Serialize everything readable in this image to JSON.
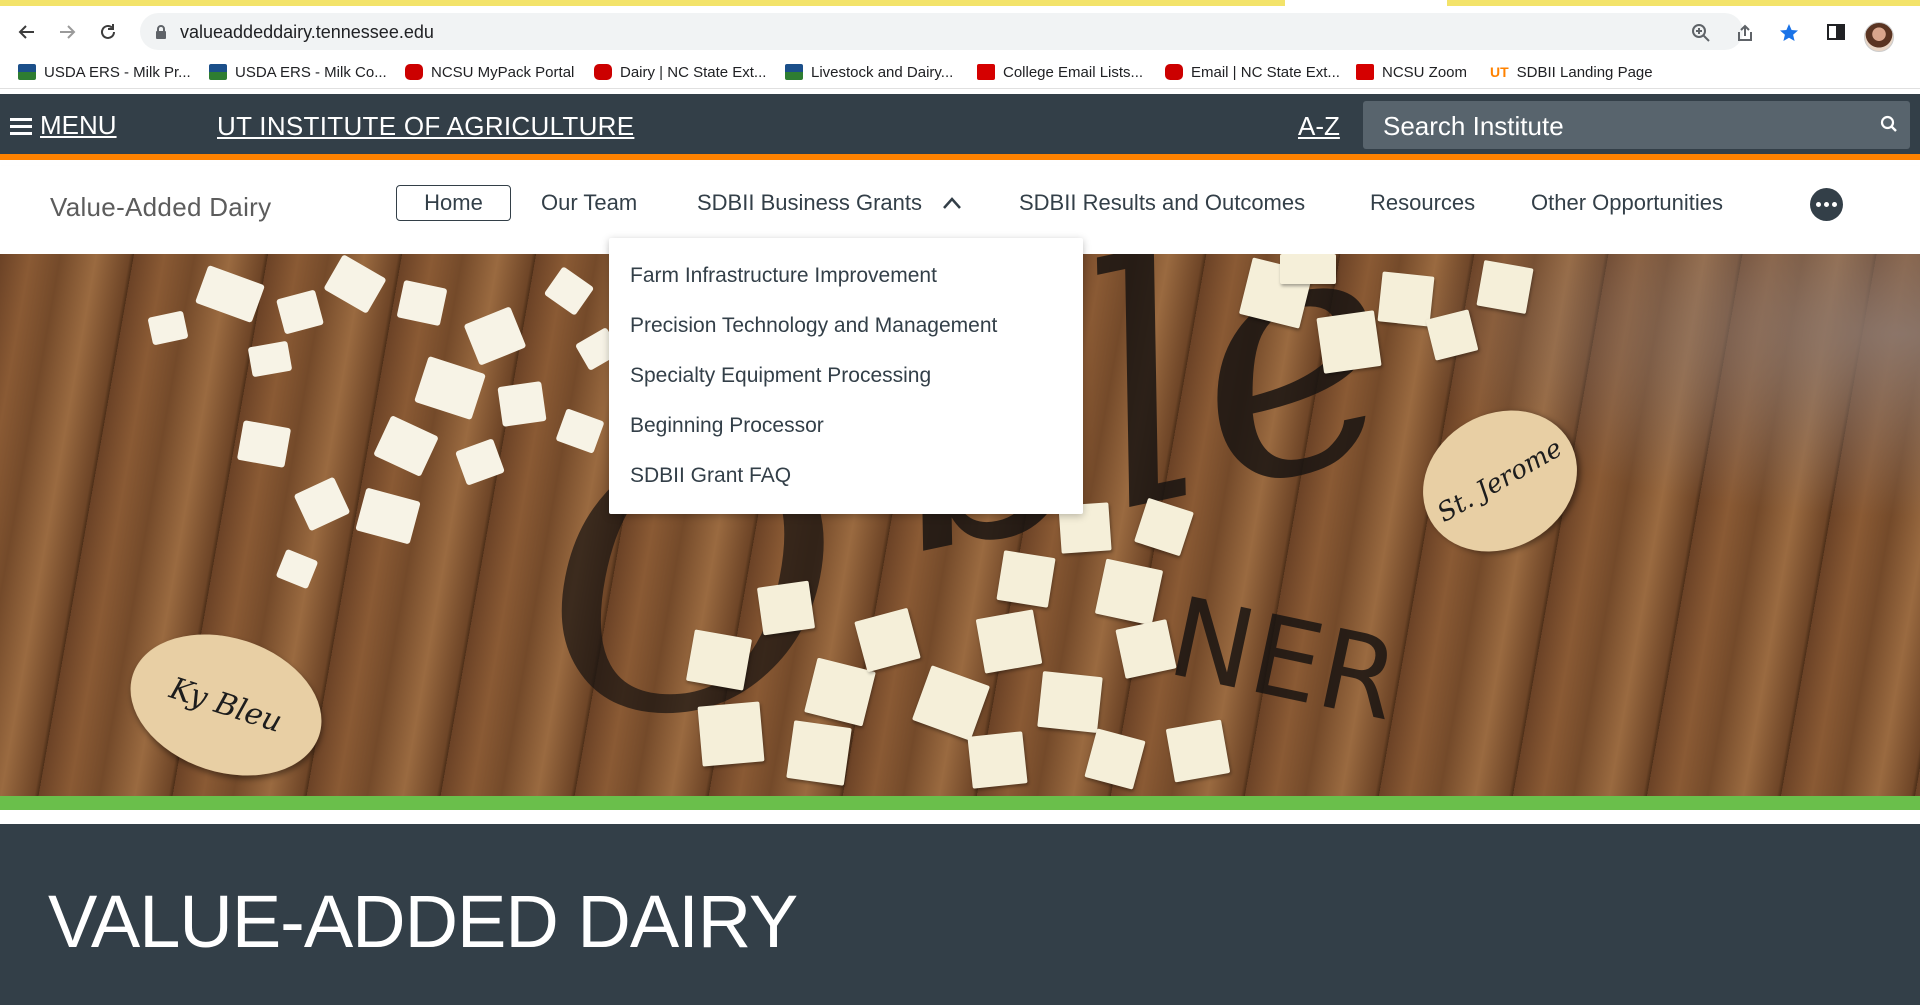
{
  "browser": {
    "url": "valueaddeddairy.tennessee.edu",
    "bookmarks": [
      {
        "label": "USDA ERS - Milk Pr...",
        "icon": "usda-icon"
      },
      {
        "label": "USDA ERS - Milk Co...",
        "icon": "usda-icon"
      },
      {
        "label": "NCSU MyPack Portal",
        "icon": "ncsu-icon"
      },
      {
        "label": "Dairy | NC State Ext...",
        "icon": "ncsu-icon"
      },
      {
        "label": "Livestock and Dairy...",
        "icon": "usda-icon"
      },
      {
        "label": "College Email Lists...",
        "icon": "wolf-icon"
      },
      {
        "label": "Email | NC State Ext...",
        "icon": "ncsu-icon"
      },
      {
        "label": "NCSU Zoom",
        "icon": "wolf-icon"
      },
      {
        "label": "SDBII Landing Page",
        "icon": "ut-icon",
        "icon_text": "UT"
      }
    ]
  },
  "institute": {
    "menu_label": "MENU",
    "title": "UT INSTITUTE OF AGRICULTURE",
    "az_label": "A-Z",
    "search_placeholder": "Search Institute"
  },
  "sitenav": {
    "site_name": "Value-Added Dairy",
    "items": [
      {
        "label": "Home"
      },
      {
        "label": "Our Team"
      },
      {
        "label": "SDBII Business Grants"
      },
      {
        "label": "SDBII Results and Outcomes"
      },
      {
        "label": "Resources"
      },
      {
        "label": "Other Opportunities"
      }
    ]
  },
  "dropdown": {
    "items": [
      {
        "label": "Farm Infrastructure Improvement"
      },
      {
        "label": "Precision Technology and Management"
      },
      {
        "label": "Specialty Equipment Processing"
      },
      {
        "label": "Beginning Processor"
      },
      {
        "label": "SDBII Grant FAQ"
      }
    ]
  },
  "hero": {
    "tag_left": "Ky Bleu",
    "tag_right": "St. Jerome",
    "barrel_text": "NER"
  },
  "page": {
    "title": "VALUE-ADDED DAIRY"
  },
  "colors": {
    "dark": "#333f48",
    "orange": "#ff8200",
    "green": "#6abf4b"
  }
}
